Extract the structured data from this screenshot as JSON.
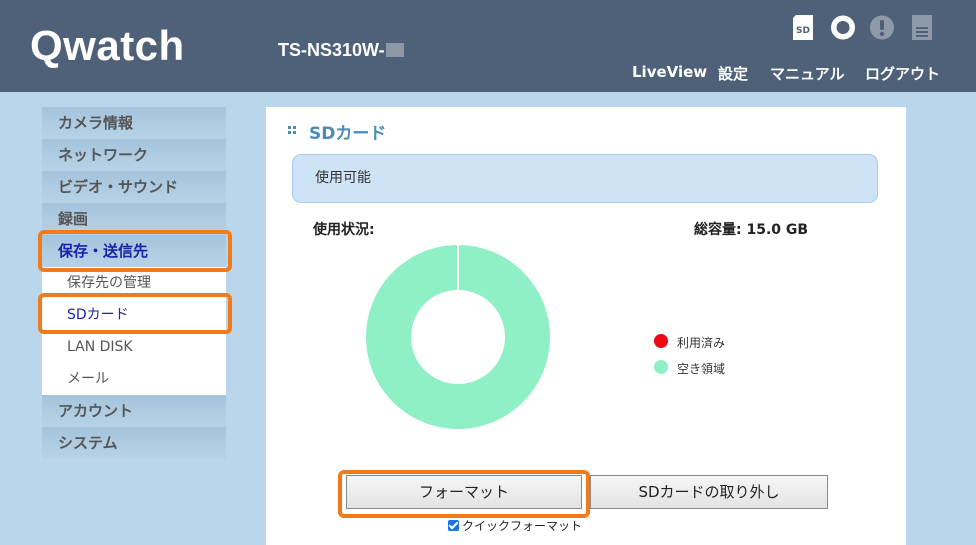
{
  "header": {
    "logo": "Qwatch",
    "model": "TS-NS310W-",
    "status_icons": [
      "sd-card-icon",
      "record-circle-icon",
      "alert-icon",
      "storage-icon"
    ],
    "nav": [
      "LiveView",
      "設定",
      "マニュアル",
      "ログアウト"
    ]
  },
  "sidebar": {
    "items": [
      {
        "label": "カメラ情報"
      },
      {
        "label": "ネットワーク"
      },
      {
        "label": "ビデオ・サウンド"
      },
      {
        "label": "録画"
      },
      {
        "label": "保存・送信先",
        "active": true
      },
      {
        "label": "保存先の管理",
        "sub": true
      },
      {
        "label": "SDカード",
        "sub": true,
        "active": true
      },
      {
        "label": "LAN DISK",
        "sub": true
      },
      {
        "label": "メール",
        "sub": true
      },
      {
        "label": "アカウント"
      },
      {
        "label": "システム"
      }
    ]
  },
  "main": {
    "title": "SDカード",
    "status": "使用可能",
    "usage_label": "使用状況:",
    "capacity": "総容量: 15.0 GB",
    "legend": [
      {
        "label": "利用済み",
        "color": "#ee0a14"
      },
      {
        "label": "空き領域",
        "color": "#8ff0c6"
      }
    ],
    "format_button": "フォーマット",
    "eject_button": "SDカードの取り外し",
    "quick_format_label": "クイックフォーマット",
    "quick_format_checked": true
  },
  "chart_data": {
    "type": "pie",
    "categories": [
      "利用済み",
      "空き領域"
    ],
    "values": [
      0,
      100
    ],
    "colors": [
      "#ee0a14",
      "#8ff0c6"
    ],
    "donut": true
  },
  "colors": {
    "header_bg": "#4e6178",
    "page_bg": "#b9d6ea",
    "highlight": "#f07a1c",
    "active_text": "#1a23a8",
    "title_text": "#4a8cb5"
  }
}
